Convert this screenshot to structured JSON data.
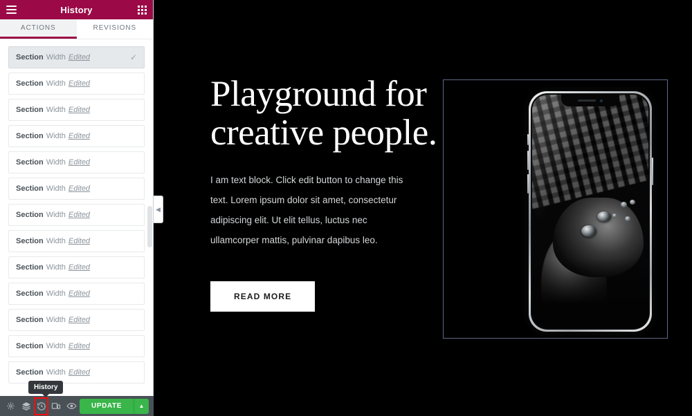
{
  "panel": {
    "header": {
      "title": "History",
      "menu_icon": "hamburger-icon",
      "apps_icon": "grid-apps-icon",
      "background": "#9b0a46"
    },
    "tabs": [
      {
        "label": "ACTIONS",
        "active": true
      },
      {
        "label": "REVISIONS",
        "active": false
      }
    ],
    "history_items": [
      {
        "type": "Section",
        "property": "Width",
        "action": "Edited",
        "active": true
      },
      {
        "type": "Section",
        "property": "Width",
        "action": "Edited",
        "active": false
      },
      {
        "type": "Section",
        "property": "Width",
        "action": "Edited",
        "active": false
      },
      {
        "type": "Section",
        "property": "Width",
        "action": "Edited",
        "active": false
      },
      {
        "type": "Section",
        "property": "Width",
        "action": "Edited",
        "active": false
      },
      {
        "type": "Section",
        "property": "Width",
        "action": "Edited",
        "active": false
      },
      {
        "type": "Section",
        "property": "Width",
        "action": "Edited",
        "active": false
      },
      {
        "type": "Section",
        "property": "Width",
        "action": "Edited",
        "active": false
      },
      {
        "type": "Section",
        "property": "Width",
        "action": "Edited",
        "active": false
      },
      {
        "type": "Section",
        "property": "Width",
        "action": "Edited",
        "active": false
      },
      {
        "type": "Section",
        "property": "Width",
        "action": "Edited",
        "active": false
      },
      {
        "type": "Section",
        "property": "Width",
        "action": "Edited",
        "active": false
      },
      {
        "type": "Section",
        "property": "Width",
        "action": "Edited",
        "active": false
      }
    ],
    "collapse_handle_icon": "chevron-left-icon",
    "active_item_check_icon": "check-icon"
  },
  "tooltip": {
    "label": "History"
  },
  "toolbar": {
    "background": "#495157",
    "buttons": [
      {
        "name": "settings",
        "icon": "gear-icon"
      },
      {
        "name": "navigator",
        "icon": "layers-icon"
      },
      {
        "name": "history",
        "icon": "history-clock-icon",
        "highlighted": true
      },
      {
        "name": "responsive-mode",
        "icon": "responsive-devices-icon"
      },
      {
        "name": "preview",
        "icon": "eye-icon"
      }
    ],
    "update_label": "UPDATE",
    "update_color": "#39b54a",
    "update_caret_icon": "chevron-up-icon",
    "highlight_color": "#f60c0c"
  },
  "canvas": {
    "background": "#000000",
    "selection_outline_color": "#5e6a86",
    "hero": {
      "title": "Playground for creative people.",
      "paragraph": "I am text block. Click edit button to change this text. Lorem ipsum dolor sit amet, consectetur adipiscing elit. Ut elit tellus, luctus nec ullamcorper mattis, pulvinar dapibus leo.",
      "button_label": "READ MORE"
    },
    "phone_mockup": {
      "device": "smartphone-notch-mockup",
      "screen_image": "grayscale-game-controller-and-keyboard"
    }
  }
}
